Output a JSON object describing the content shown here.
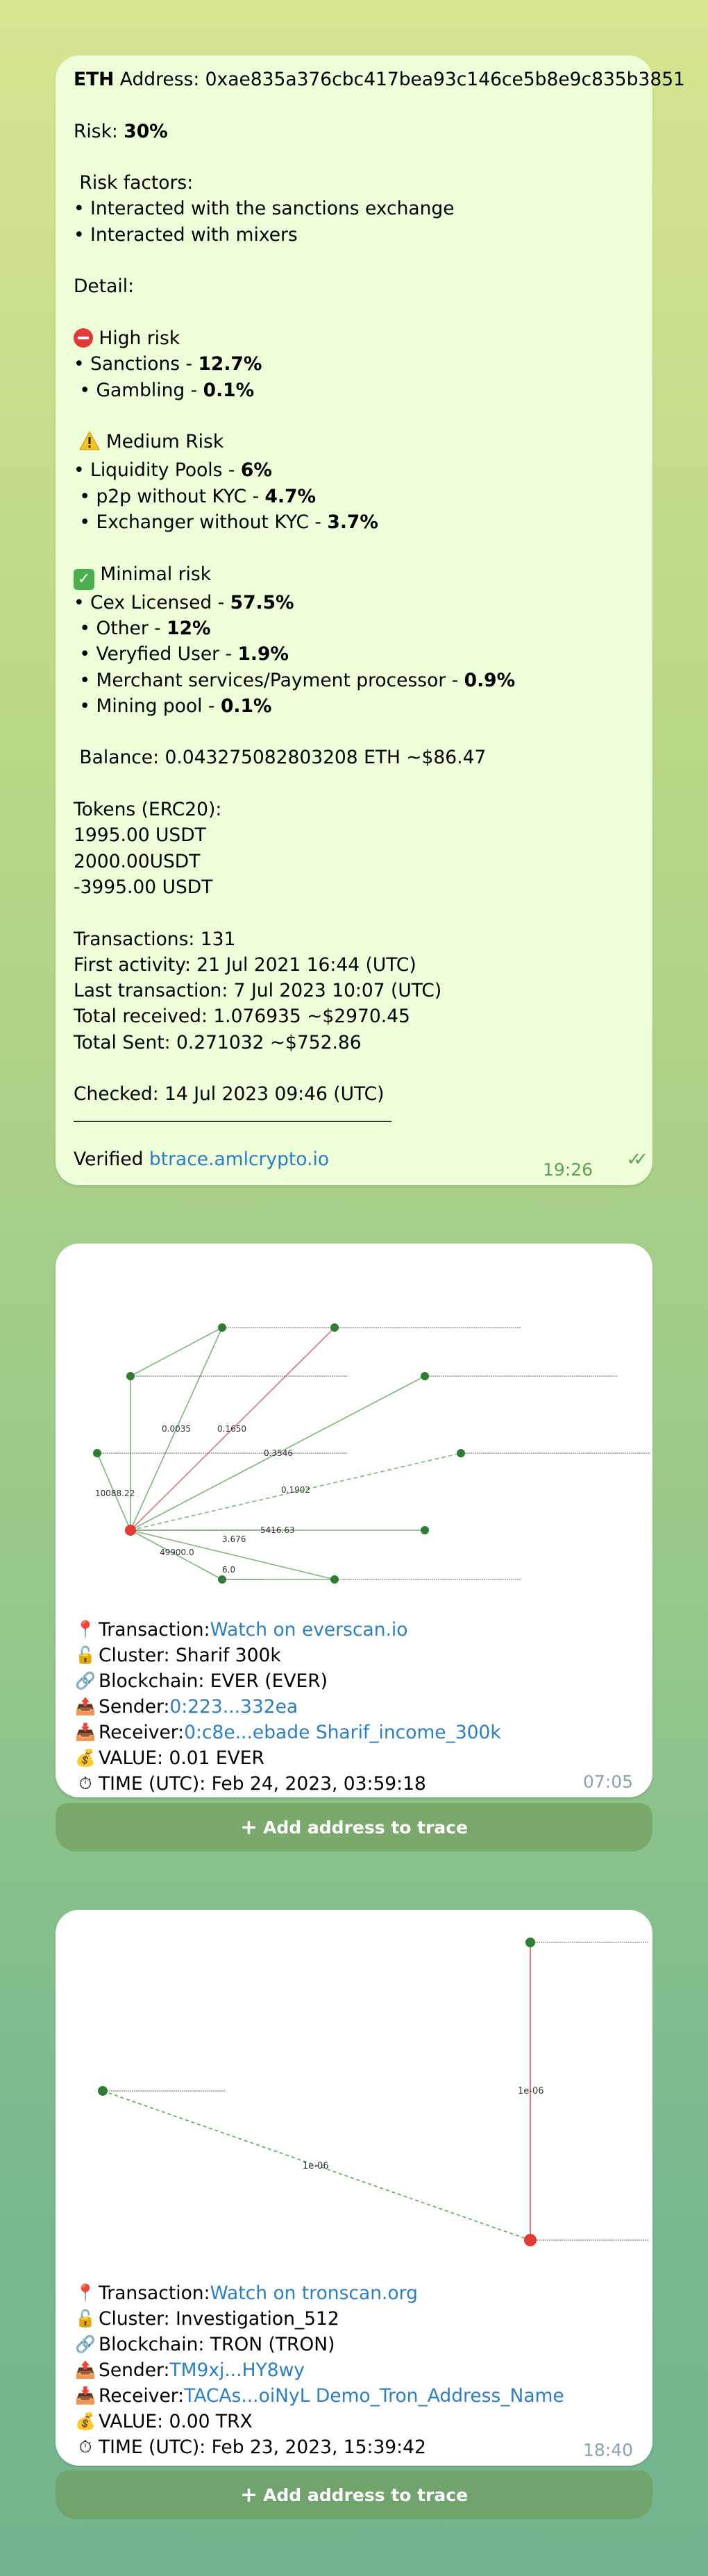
{
  "msg1": {
    "coin": "ETH",
    "address_line": " Address: 0xae835a376cbc417bea93c146ce5b8e9c835b3851",
    "risk_label": "Risk: ",
    "risk_value": "30%",
    "risk_factors_title": " Risk factors:",
    "factor1": "• Interacted with the sanctions exchange",
    "factor2": "• Interacted with mixers",
    "detail": "Detail:",
    "high_title": " High risk",
    "high_items": [
      {
        "pre": "• Sanctions - ",
        "val": "12.7%"
      },
      {
        "pre": " • Gambling - ",
        "val": "0.1%"
      }
    ],
    "medium_title": " Medium Risk",
    "medium_items": [
      {
        "pre": "• Liquidity Pools - ",
        "val": "6%"
      },
      {
        "pre": " • p2p without KYC - ",
        "val": "4.7%"
      },
      {
        "pre": " • Exchanger without KYC - ",
        "val": "3.7%"
      }
    ],
    "minimal_title": " Minimal risk",
    "minimal_items": [
      {
        "pre": "• Cex Licensed - ",
        "val": "57.5%"
      },
      {
        "pre": " • Other - ",
        "val": "12%"
      },
      {
        "pre": " • Veryfied User - ",
        "val": "1.9%"
      },
      {
        "pre": " • Merchant services/Payment processor - ",
        "val": "0.9%"
      },
      {
        "pre": " • Mining pool - ",
        "val": "0.1%"
      }
    ],
    "balance": " Balance: 0.043275082803208 ETH ~$86.47",
    "tokens_title": "Tokens (ERC20):",
    "tokens": [
      "1995.00 USDT",
      "2000.00USDT",
      "-3995.00 USDT"
    ],
    "transactions": "Transactions: 131",
    "first_activity": "First activity: 21 Jul 2021 16:44 (UTC)",
    "last_transaction": "Last transaction: 7 Jul 2023 10:07 (UTC)",
    "total_received": "Total received: 1.076935 ~$2970.45",
    "total_sent": "Total Sent: 0.271032 ~$752.86",
    "checked": "Checked: 14 Jul 2023 09:46 (UTC)",
    "verified_label": "Verified ",
    "verified_link": "btrace.amlcrypto.io",
    "time": "19:26"
  },
  "msg2": {
    "graph_labels": [
      "0.0035",
      "0.1650",
      "0.3546",
      "10088.22",
      "0.1902",
      "3.676",
      "5416.63",
      "49900.0",
      "6.0"
    ],
    "transaction_label": "Transaction: ",
    "transaction_link": "Watch on everscan.io",
    "cluster": "Cluster: Sharif 300k",
    "blockchain": "Blockchain: EVER (EVER)",
    "sender_label": "Sender: ",
    "sender_link": "0:223...332ea",
    "receiver_label": "Receiver: ",
    "receiver_link": "0:c8e...ebade Sharif_income_300k",
    "value": "VALUE: 0.01 EVER",
    "time_utc": "TIME (UTC): Feb 24, 2023, 03:59:18",
    "time": "07:05",
    "button": "Add address to trace"
  },
  "msg3": {
    "graph_labels": [
      "1e-06",
      "1e-06"
    ],
    "transaction_label": "Transaction: ",
    "transaction_link": "Watch on tronscan.org",
    "cluster": "Cluster: Investigation_512",
    "blockchain": "Blockchain: TRON (TRON)",
    "sender_label": "Sender: ",
    "sender_link": "TM9xj...HY8wy",
    "receiver_label": "Receiver: ",
    "receiver_link": "TACAs...oiNyL Demo_Tron_Address_Name",
    "value": "VALUE: 0.00 TRX",
    "time_utc": "TIME (UTC): Feb 23, 2023, 15:39:42",
    "time": "18:40",
    "button": "Add address to trace"
  },
  "icons": {
    "no_entry": "no-entry-icon",
    "warning": "warning-icon",
    "check": "check-mark-icon",
    "pin": "pin-icon",
    "lock": "lock-icon",
    "link": "link-icon",
    "outbox": "outbox-tray-icon",
    "inbox": "inbox-tray-icon",
    "money": "money-bag-icon",
    "stopwatch": "stopwatch-icon",
    "plus": "plus-icon",
    "read": "double-check-icon"
  },
  "colors": {
    "outgoing_bubble": "#eefed9",
    "incoming_bubble": "#ffffff",
    "link": "#2a7fc6",
    "time_green": "#5ea355",
    "node_green": "#2e7d32",
    "node_red": "#e53935",
    "edge_green": "#7cb879",
    "edge_red": "#e57373"
  }
}
